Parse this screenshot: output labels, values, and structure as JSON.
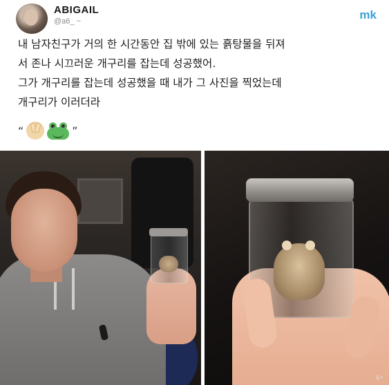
{
  "post": {
    "username": "ABIGAIL",
    "handle": "@a6_ ~",
    "watermark": "mk",
    "lines": [
      "내 남자친구가 거의 한 시간동안 집 밖에 있는 흙탕물을 뒤져",
      "서 존나 시끄러운 개구리를 잡는데 성공했어.",
      "그가 개구리를 잡는데 성공했을 때 내가 그 사진을 찍었는데",
      "개구리가 이러더라"
    ],
    "quote_open": "“",
    "quote_close": "”",
    "emoji_1": "peace-hand-icon",
    "emoji_2": "frog-face-icon"
  },
  "photos": {
    "left_alt": "man holding frog in jar",
    "right_alt": "close-up of frog in jar"
  },
  "corner_text": "&+"
}
